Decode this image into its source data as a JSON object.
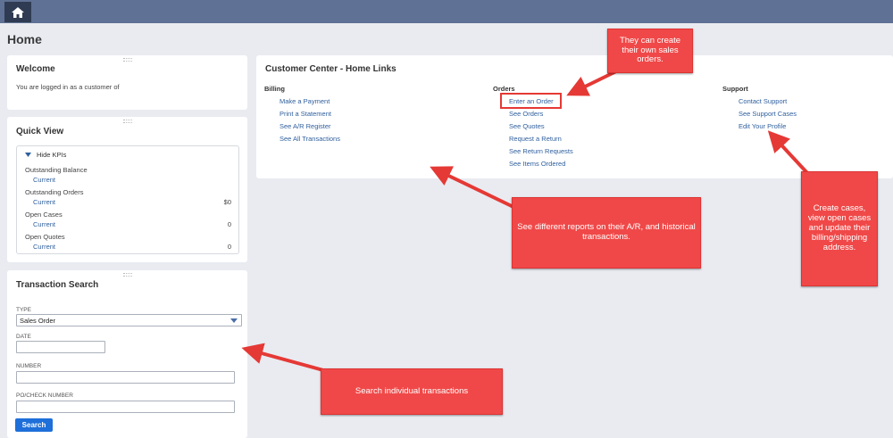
{
  "title": "Home",
  "welcome": {
    "title": "Welcome",
    "text": "You are logged in as a customer of"
  },
  "quick_view": {
    "title": "Quick View",
    "toggle": "Hide KPIs",
    "kpis": [
      {
        "label": "Outstanding Balance",
        "period": "Current",
        "value": ""
      },
      {
        "label": "Outstanding Orders",
        "period": "Current",
        "value": "$0"
      },
      {
        "label": "Open Cases",
        "period": "Current",
        "value": "0"
      },
      {
        "label": "Open Quotes",
        "period": "Current",
        "value": "0"
      }
    ]
  },
  "transaction_search": {
    "title": "Transaction Search",
    "type_label": "TYPE",
    "type_value": "Sales Order",
    "date_label": "DATE",
    "number_label": "NUMBER",
    "po_label": "PO/CHECK NUMBER",
    "search_button": "Search"
  },
  "home_links": {
    "title": "Customer Center - Home Links",
    "billing": {
      "heading": "Billing",
      "links": [
        "Make a Payment",
        "Print a Statement",
        "See A/R Register",
        "See All Transactions"
      ]
    },
    "orders": {
      "heading": "Orders",
      "links": [
        "Enter an Order",
        "See Orders",
        "See Quotes",
        "Request a Return",
        "See Return Requests",
        "See Items Ordered"
      ]
    },
    "support": {
      "heading": "Support",
      "links": [
        "Contact Support",
        "See Support Cases",
        "Edit Your Profile"
      ]
    }
  },
  "callouts": {
    "orders": "They can create their own sales orders.",
    "reports": "See different reports on their A/R, and historical transactions.",
    "support": "Create cases, view open cases and update their billing/shipping address.",
    "search": "Search individual transactions"
  },
  "colors": {
    "accent": "#1e6fd9",
    "topbar": "#5f7194",
    "callout": "#f04848",
    "link": "#2f5f9e"
  },
  "icons": {
    "home": "home-icon",
    "toggle": "triangle-down-icon",
    "select": "chevron-down-icon"
  }
}
